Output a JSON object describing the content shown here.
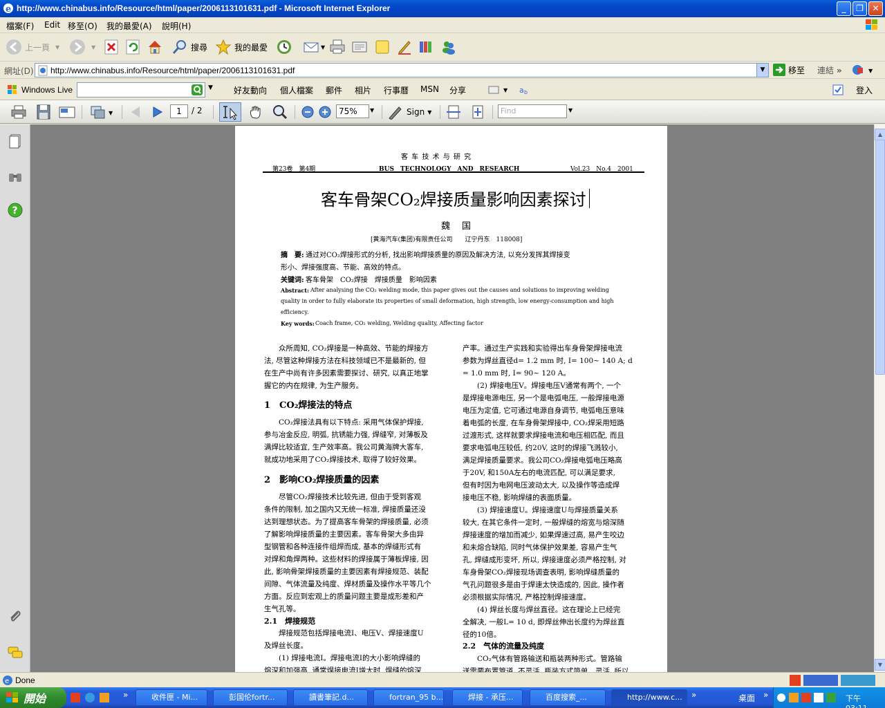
{
  "window": {
    "title": "http://www.chinabus.info/Resource/html/paper/2006113101631.pdf - Microsoft Internet Explorer",
    "minimize": "_",
    "maximize": "❐",
    "close": "✕"
  },
  "menu": [
    "檔案(F)",
    "Edit",
    "移至(O)",
    "我的最愛(A)",
    "說明(H)"
  ],
  "toolbar": {
    "back": "上一頁",
    "search": "搜尋",
    "favorites": "我的最愛"
  },
  "address": {
    "label": "網址(D)",
    "url": "http://www.chinabus.info/Resource/html/paper/2006113101631.pdf",
    "go": "移至",
    "links": "連結",
    "more": "»"
  },
  "live": {
    "brand": "Windows Live",
    "items": [
      "好友動向",
      "個人檔案",
      "郵件",
      "相片",
      "行事曆",
      "MSN",
      "分享"
    ],
    "signin": "登入"
  },
  "pdf": {
    "page_current": "1",
    "page_total": "/ 2",
    "zoom": "75%",
    "sign": "Sign",
    "find_placeholder": "Find"
  },
  "paper": {
    "journal": "客 车 技 术 与 研 究",
    "vol_cn": "第23卷　第4期",
    "journal_en": "BUS　TECHNOLOGY　AND　RESEARCH",
    "vol_en": "Vol.23　No.4　2001",
    "title": "客车骨架CO₂焊接质量影响因素探讨",
    "author": "魏　国",
    "affiliation": "[黄海汽车(集团)有限责任公司　　辽宁丹东　118008]",
    "abstract_cn_label": "摘　要:",
    "abstract_cn_1": "通过对CO₂焊接形式的分析, 找出影响焊接质量的原因及解决方法, 以充分发挥其焊接变",
    "abstract_cn_2": "形小、焊接强度高、节能、高效的特点。",
    "keywords_cn_label": "关键词:",
    "keywords_cn": "客车骨架　CO₂焊接　焊接质量　影响因素",
    "abstract_en_label": "Abstract:",
    "abstract_en_1": "After analysing the CO₂ welding mode, this paper gives out the causes and solutions to improving welding",
    "abstract_en_2": "quality in order to fully elaborate its properties of small deformation, high strength, low energy-consumption and high",
    "abstract_en_3": "efficiency.",
    "keywords_en_label": "Key words:",
    "keywords_en": "Coach frame, CO₂ welding, Welding quality, Affecting factor",
    "left_col": [
      "　　众所周知, CO₂焊接是一种高效、节能的焊接方",
      "法, 尽管这种焊接方法在科技领域已不是最新的, 但",
      "在生产中尚有许多因素需要探讨、研究, 以真正地掌",
      "握它的内在规律, 为生产服务。"
    ],
    "sec1": "1　CO₂焊接法的特点",
    "sec1_body": [
      "　　CO₂焊接法具有以下特点: 采用气体保护焊接,",
      "参与冶金反应, 明弧, 抗锈能力强, 焊缝窄, 对薄板及",
      "满焊比较适宜, 生产效率高。我公司黄海牌大客车,",
      "就成功地采用了CO₂焊接技术, 取得了较好效果。"
    ],
    "sec2": "2　影响CO₂焊接质量的因素",
    "sec2_body": [
      "　　尽管CO₂焊接技术比较先进, 但由于受到客观",
      "条件的限制, 加之国内又无统一标准, 焊接质量还没",
      "达到理想状态。为了提高客车骨架的焊接质量, 必须",
      "了解影响焊接质量的主要因素。客车骨架大多由异",
      "型钢管和各种连接件组焊而成, 基本的焊缝形式有",
      "对焊和角焊两种。这些材料的焊接属于薄板焊接, 因",
      "此, 影响骨架焊接质量的主要因素有焊接规范、装配",
      "间隙、气体流量及纯度、焊材质量及操作水平等几个",
      "方面。反应到宏观上的质量问题主要是成形差和产",
      "生气孔等。"
    ],
    "sec21": "2.1　焊接规范",
    "sec21_body": [
      "　　焊接规范包括焊接电流I、电压V、焊接速度U",
      "及焊丝长度。",
      "　　(1) 焊接电流I。焊接电流I的大小影响焊缝的",
      "熔深和加强高, 通常焊接电流I增大时, 焊缝的熔深"
    ],
    "right_col": [
      "产率。通过生产实践和实验得出车身骨架焊接电流",
      "参数为焊丝直径d= 1.2 mm 时, I= 100~ 140 A; d",
      "= 1.0 mm 时, I= 90~ 120 A。",
      "　　(2) 焊接电压V。焊接电压V通常有两个, 一个",
      "是焊接电源电压, 另一个是电弧电压, 一般焊接电源",
      "电压为定值, 它可通过电源自身调节, 电弧电压意味",
      "着电弧的长度, 在车身骨架焊接中, CO₂焊采用短路",
      "过渡形式, 这样就要求焊接电流和电压相匹配, 而且",
      "要求电弧电压较低, 约20V, 这时的焊接飞溅较小,",
      "满足焊接质量要求。我公司CO₂焊接电弧电压略高",
      "于20V, 和150A左右的电流匹配, 可以满足要求,",
      "但有时因为电网电压波动太大, 以及操作等造成焊",
      "接电压不稳, 影响焊缝的表面质量。",
      "　　(3) 焊接速度U。焊接速度U与焊接质量关系",
      "较大, 在其它条件一定时, 一般焊缝的熔宽与熔深随",
      "焊接速度的增加而减少, 如果焊速过高, 易产生咬边",
      "和未熔合缺陷, 同时气体保护效果差, 容易产生气",
      "孔, 焊缝成形变坏, 所以, 焊接速度必须严格控制, 对",
      "车身骨架CO₂焊接现场调查表明, 影响焊缝质量的",
      "气孔问题很多是由于焊速太快造成的, 因此, 操作者",
      "必须根据实际情况, 严格控制焊接速度。",
      "　　(4) 焊丝长度与焊丝直径。这在理论上已经完",
      "全解决, 一般L= 10 d, 即焊丝伸出长度约为焊丝直",
      "径的10倍。"
    ],
    "sec22": "2.2　气体的流量及纯度",
    "sec22_body": [
      "　　CO₂气体有管路输送和瓶装两种形式。管路输",
      "送需要布置管道, 不灵活, 瓶装方式简单、灵活, 所以"
    ]
  },
  "status": {
    "text": "Done"
  },
  "taskbar": {
    "start": "開始",
    "tasks": [
      "收件匣 - Mi...",
      "彭国伦fortr...",
      "讀書筆記.d...",
      "fortran_95 b...",
      "焊接 - 承压...",
      "百度搜索_...",
      "http://www.c..."
    ],
    "desktop": "桌面",
    "clock": "下午 03:11"
  }
}
